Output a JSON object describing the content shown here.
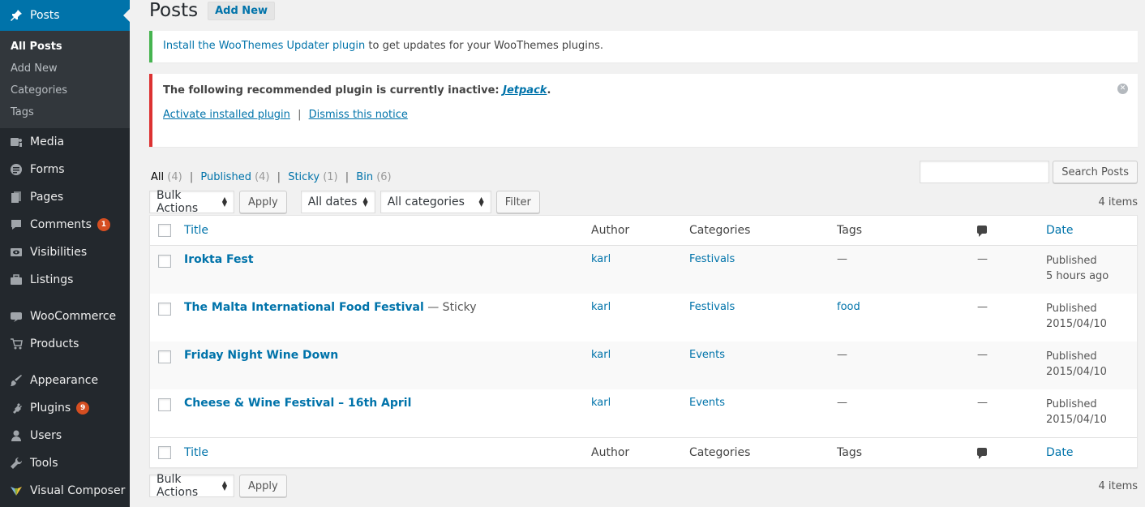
{
  "sidebar": {
    "items": [
      {
        "name": "posts",
        "label": "Posts",
        "icon": "pushpin-icon",
        "current": true
      },
      {
        "name": "media",
        "label": "Media",
        "icon": "media-icon"
      },
      {
        "name": "forms",
        "label": "Forms",
        "icon": "forms-icon"
      },
      {
        "name": "pages",
        "label": "Pages",
        "icon": "pages-icon"
      },
      {
        "name": "comments",
        "label": "Comments",
        "icon": "comment-icon",
        "badge": "1"
      },
      {
        "name": "visibilities",
        "label": "Visibilities",
        "icon": "eye-icon"
      },
      {
        "name": "listings",
        "label": "Listings",
        "icon": "briefcase-icon"
      },
      {
        "name": "woocommerce",
        "label": "WooCommerce",
        "icon": "woo-icon"
      },
      {
        "name": "products",
        "label": "Products",
        "icon": "cart-icon"
      },
      {
        "name": "appearance",
        "label": "Appearance",
        "icon": "brush-icon"
      },
      {
        "name": "plugins",
        "label": "Plugins",
        "icon": "plug-icon",
        "badge": "9"
      },
      {
        "name": "users",
        "label": "Users",
        "icon": "user-icon"
      },
      {
        "name": "tools",
        "label": "Tools",
        "icon": "wrench-icon"
      },
      {
        "name": "visual-composer",
        "label": "Visual Composer",
        "icon": "vc-icon"
      }
    ],
    "submenu": [
      "All Posts",
      "Add New",
      "Categories",
      "Tags"
    ]
  },
  "header": {
    "title": "Posts",
    "add_new": "Add New"
  },
  "notice_update": {
    "link": "Install the WooThemes Updater plugin",
    "text": " to get updates for your WooThemes plugins."
  },
  "notice_plugin": {
    "text": "The following recommended plugin is currently inactive: ",
    "plugin": "Jetpack",
    "period": ".",
    "activate": "Activate installed plugin",
    "separator": "|",
    "dismiss": "Dismiss this notice"
  },
  "filters": {
    "all": "All",
    "all_count": "(4)",
    "published": "Published",
    "published_count": "(4)",
    "sticky": "Sticky",
    "sticky_count": "(1)",
    "bin": "Bin",
    "bin_count": "(6)",
    "sep": "|"
  },
  "search": {
    "value": "",
    "button": "Search Posts"
  },
  "tablenav": {
    "bulk_actions": "Bulk Actions",
    "apply": "Apply",
    "dates": "All dates",
    "categories": "All categories",
    "filter": "Filter",
    "items": "4 items"
  },
  "table": {
    "columns": {
      "title": "Title",
      "author": "Author",
      "categories": "Categories",
      "tags": "Tags",
      "date": "Date"
    },
    "rows": [
      {
        "title": "Irokta Fest",
        "sticky": "",
        "author": "karl",
        "category": "Festivals",
        "tags": "—",
        "comments": "—",
        "status": "Published",
        "date": "5 hours ago"
      },
      {
        "title": "The Malta International Food Festival",
        "sticky": " — Sticky",
        "author": "karl",
        "category": "Festivals",
        "tags": "food",
        "comments": "—",
        "status": "Published",
        "date": "2015/04/10"
      },
      {
        "title": "Friday Night Wine Down",
        "sticky": "",
        "author": "karl",
        "category": "Events",
        "tags": "—",
        "comments": "—",
        "status": "Published",
        "date": "2015/04/10"
      },
      {
        "title": "Cheese & Wine Festival – 16th April",
        "sticky": "",
        "author": "karl",
        "category": "Events",
        "tags": "—",
        "comments": "—",
        "status": "Published",
        "date": "2015/04/10"
      }
    ]
  },
  "colors": {
    "sidebar": "#23282d",
    "accent": "#0073aa",
    "notice_success": "#46b450",
    "notice_error": "#dc3232",
    "badge": "#d54e21"
  }
}
